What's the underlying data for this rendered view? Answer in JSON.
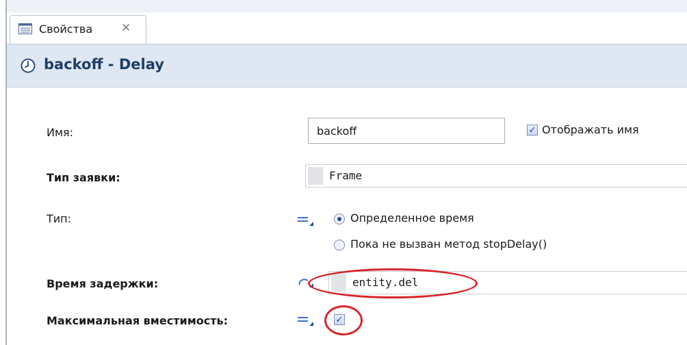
{
  "tab": {
    "title": "Свойства",
    "close_glyph": "✕",
    "icon": "properties-icon"
  },
  "header": {
    "title": "backoff - Delay",
    "icon": "clock-icon"
  },
  "fields": {
    "name_label": "Имя:",
    "name_value": "backoff",
    "show_name_label": "Отображать имя",
    "show_name_checked": true,
    "agent_type_label": "Тип заявки:",
    "agent_type_value": "Frame",
    "type_label": "Тип:",
    "type_options": [
      "Определенное время",
      "Пока не вызван метод stopDelay()"
    ],
    "type_selected_index": 0,
    "delay_label": "Время задержки:",
    "delay_value": "entity.del",
    "max_capacity_label": "Максимальная вместимость:",
    "max_capacity_checked": true
  },
  "colors": {
    "header_bg": "#dfe7f2",
    "header_text": "#1f3f63",
    "annotation_red": "#d8262b",
    "check_blue": "#1b3f9c"
  }
}
